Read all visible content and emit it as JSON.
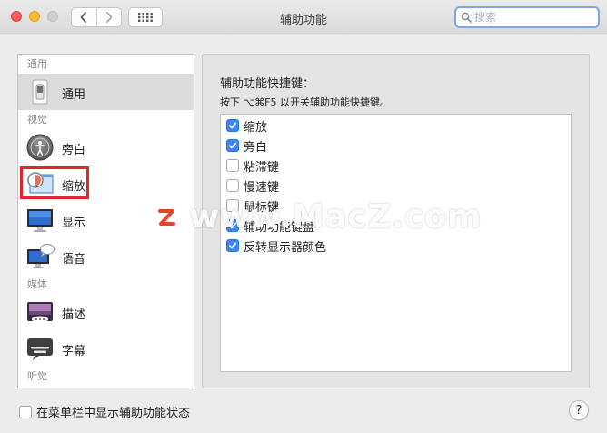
{
  "window": {
    "title": "辅助功能",
    "search_placeholder": "搜索"
  },
  "sidebar": {
    "sections": [
      {
        "label": "通用",
        "items": [
          {
            "label": "通用",
            "icon": "switch-icon",
            "selected": true
          }
        ]
      },
      {
        "label": "视觉",
        "items": [
          {
            "label": "旁白",
            "icon": "voiceover-icon"
          },
          {
            "label": "缩放",
            "icon": "zoom-icon",
            "highlighted": true
          },
          {
            "label": "显示",
            "icon": "display-icon"
          },
          {
            "label": "语音",
            "icon": "speech-icon"
          }
        ]
      },
      {
        "label": "媒体",
        "items": [
          {
            "label": "描述",
            "icon": "descriptions-icon"
          },
          {
            "label": "字幕",
            "icon": "captions-icon"
          }
        ]
      },
      {
        "label": "听觉",
        "items": []
      }
    ]
  },
  "main": {
    "heading": "辅助功能快捷键：",
    "hint": "按下 ⌥⌘F5 以开关辅助功能快捷键。",
    "options": [
      {
        "label": "缩放",
        "checked": true
      },
      {
        "label": "旁白",
        "checked": true
      },
      {
        "label": "粘滞键",
        "checked": false
      },
      {
        "label": "慢速键",
        "checked": false
      },
      {
        "label": "鼠标键",
        "checked": false
      },
      {
        "label": "辅助功能键盘",
        "checked": true
      },
      {
        "label": "反转显示器颜色",
        "checked": true
      }
    ]
  },
  "footer": {
    "menubar_checkbox_label": "在菜单栏中显示辅助功能状态",
    "menubar_checked": false,
    "help_label": "?"
  },
  "watermark": {
    "text": "www.MacZ.com",
    "logo_letter": "Z"
  },
  "colors": {
    "accent": "#3b86f7",
    "highlight": "#e4252a",
    "watermark_logo": "#e8432c"
  }
}
